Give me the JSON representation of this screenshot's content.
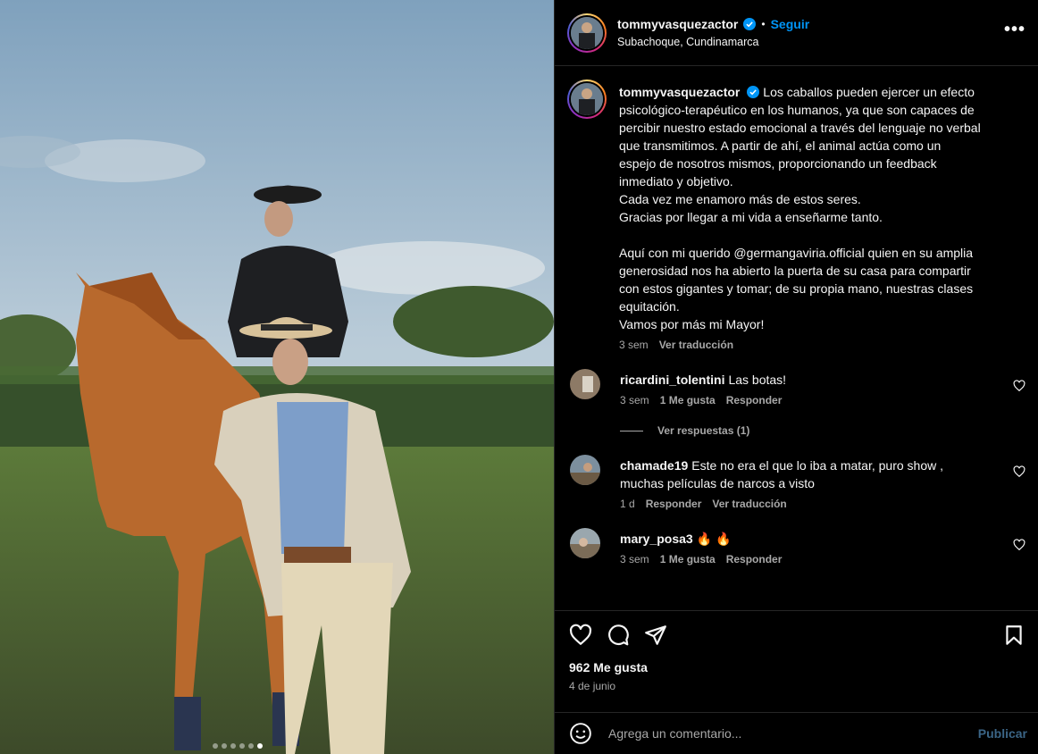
{
  "post": {
    "username": "tommyvasquezactor",
    "verified": true,
    "follow_label": "Seguir",
    "separator": "•",
    "location": "Subachoque, Cundinamarca",
    "more_label": "•••"
  },
  "caption": {
    "username": "tommyvasquezactor",
    "first_line": "Los caballos pueden ejercer un efecto",
    "lines": [
      "psicológico-terapéutico en los humanos, ya que son capaces de",
      "percibir nuestro estado emocional a través del lenguaje no verbal",
      "que transmitimos. A partir de ahí, el animal actúa como un",
      "espejo de nosotros mismos, proporcionando un feedback",
      "inmediato y objetivo.",
      "Cada vez me enamoro más de estos seres.",
      "Gracias por llegar a mi vida a enseñarme tanto."
    ],
    "lines2": [
      "Aquí con mi querido @germangaviria.official quien en su amplia",
      "generosidad nos ha abierto la puerta de su casa para compartir",
      "con estos gigantes y tomar; de su propia mano, nuestras clases",
      "equitación.",
      "Vamos por más mi Mayor!"
    ],
    "time": "3 sem",
    "translate": "Ver traducción"
  },
  "comments": [
    {
      "username": "ricardini_tolentini",
      "text": "Las botas!",
      "text2": "",
      "time": "3 sem",
      "likes": "1 Me gusta",
      "reply": "Responder",
      "view_replies": "Ver respuestas (1)"
    },
    {
      "username": "chamade19",
      "text": "Este no era el que lo iba a matar, puro show ,",
      "text2": "muchas películas de narcos a visto",
      "time": "1 d",
      "reply": "Responder",
      "translate": "Ver traducción"
    },
    {
      "username": "mary_posa3",
      "text": "🔥 🔥",
      "text2": "",
      "time": "3 sem",
      "likes": "1 Me gusta",
      "reply": "Responder"
    }
  ],
  "footer": {
    "likes": "962 Me gusta",
    "date": "4 de junio",
    "comment_placeholder": "Agrega un comentario...",
    "publish_label": "Publicar"
  },
  "carousel": {
    "count": 6,
    "active_index": 5
  },
  "colors": {
    "accent": "#0095f6",
    "muted": "#a8a8a8",
    "background": "#000000"
  }
}
